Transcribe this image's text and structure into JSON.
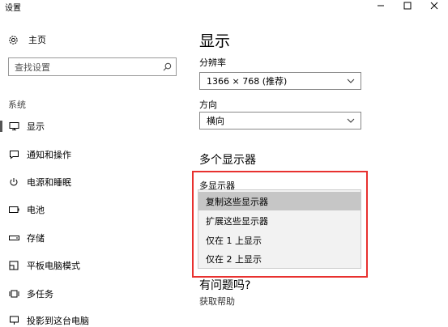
{
  "window": {
    "title": "设置",
    "minimize_glyph": "—",
    "maximize_glyph": "□",
    "close_glyph": "✕"
  },
  "sidebar": {
    "home_label": "主页",
    "search_placeholder": "查找设置",
    "section_label": "系统",
    "items": [
      {
        "label": "显示",
        "icon": "monitor-icon",
        "selected": true
      },
      {
        "label": "通知和操作",
        "icon": "notification-icon"
      },
      {
        "label": "电源和睡眠",
        "icon": "power-icon"
      },
      {
        "label": "电池",
        "icon": "battery-icon"
      },
      {
        "label": "存储",
        "icon": "storage-icon"
      },
      {
        "label": "平板电脑模式",
        "icon": "tablet-mode-icon"
      },
      {
        "label": "多任务",
        "icon": "multitasking-icon"
      },
      {
        "label": "投影到这台电脑",
        "icon": "project-icon"
      }
    ]
  },
  "main": {
    "title": "显示",
    "resolution": {
      "label": "分辨率",
      "value": "1366 × 768 (推荐)"
    },
    "orientation": {
      "label": "方向",
      "value": "横向"
    },
    "multi_display_heading": "多个显示器",
    "multi_display": {
      "label": "多显示器",
      "options": [
        "复制这些显示器",
        "扩展这些显示器",
        "仅在 1 上显示",
        "仅在 2 上显示"
      ],
      "selected_index": 0
    },
    "help": {
      "title": "有问题吗?",
      "link": "获取帮助"
    }
  },
  "colors": {
    "highlight_border": "#e8312f",
    "selected_option": "#c6c6c6",
    "dropdown_bg": "#f2f2f2"
  }
}
